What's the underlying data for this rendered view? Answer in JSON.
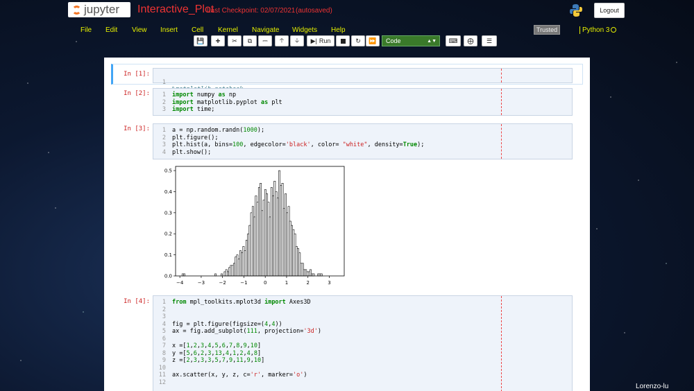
{
  "header": {
    "logo_text": "jupyter",
    "notebook_title": "Interactive_Plot",
    "checkpoint": "Last Checkpoint: 02/07/2021",
    "autosave": "(autosaved)",
    "logout_label": "Logout"
  },
  "menubar": {
    "items": [
      "File",
      "Edit",
      "View",
      "Insert",
      "Cell",
      "Kernel",
      "Navigate",
      "Widgets",
      "Help"
    ],
    "trusted_label": "Trusted",
    "kernel_name": "Python 3"
  },
  "toolbar": {
    "run_label": "Run",
    "cell_type": "Code"
  },
  "cells": [
    {
      "prompt": "In [1]:",
      "lines": [
        "%matplotlib notebook"
      ]
    },
    {
      "prompt": "In [2]:",
      "lines": [
        "import numpy as np",
        "import matplotlib.pyplot as plt",
        "import time;"
      ]
    },
    {
      "prompt": "In [3]:",
      "lines": [
        "a = np.random.randn(1000);",
        "plt.figure();",
        "plt.hist(a, bins=100, edgecolor='black', color= \"white\", density=True);",
        "plt.show();"
      ]
    },
    {
      "prompt": "In [4]:",
      "lines": [
        "from mpl_toolkits.mplot3d import Axes3D",
        "",
        "",
        "fig = plt.figure(figsize=(4,4))",
        "ax = fig.add_subplot(111, projection='3d')",
        "",
        "x =[1,2,3,4,5,6,7,8,9,10]",
        "y =[5,6,2,3,13,4,1,2,4,8]",
        "z =[2,3,3,3,5,7,9,11,9,10]",
        "",
        "ax.scatter(x, y, z, c='r', marker='o')",
        ""
      ]
    }
  ],
  "chart_data": {
    "type": "bar",
    "title": "",
    "xlabel": "",
    "ylabel": "",
    "xlim": [
      -4.2,
      3.7
    ],
    "ylim": [
      0,
      0.52
    ],
    "xticks": [
      "−4",
      "−3",
      "−2",
      "−1",
      "0",
      "1",
      "2",
      "3"
    ],
    "yticks": [
      "0.0",
      "0.1",
      "0.2",
      "0.3",
      "0.4",
      "0.5"
    ],
    "bar_fill": "#ffffff",
    "bar_edge": "#000000",
    "bins_start": -3.9,
    "bin_width": 0.073,
    "values": [
      0.01,
      0.01,
      0,
      0,
      0,
      0,
      0,
      0,
      0,
      0,
      0,
      0,
      0,
      0,
      0,
      0,
      0,
      0,
      0,
      0,
      0,
      0.01,
      0,
      0,
      0,
      0.01,
      0,
      0.02,
      0.03,
      0.02,
      0.04,
      0.05,
      0.05,
      0.06,
      0.09,
      0.1,
      0.08,
      0.12,
      0.11,
      0.14,
      0.12,
      0.17,
      0.2,
      0.24,
      0.3,
      0.33,
      0.28,
      0.38,
      0.35,
      0.42,
      0.44,
      0.31,
      0.36,
      0.41,
      0.39,
      0.35,
      0.28,
      0.42,
      0.38,
      0.45,
      0.4,
      0.37,
      0.5,
      0.43,
      0.44,
      0.32,
      0.39,
      0.3,
      0.33,
      0.26,
      0.24,
      0.22,
      0.2,
      0.14,
      0.13,
      0.11,
      0.06,
      0.06,
      0.03,
      0.03,
      0.02,
      0.02,
      0.03,
      0.01,
      0.01,
      0,
      0,
      0.01,
      0.01,
      0.01
    ],
    "grid": false
  },
  "watermark": "Lorenzo-lu"
}
